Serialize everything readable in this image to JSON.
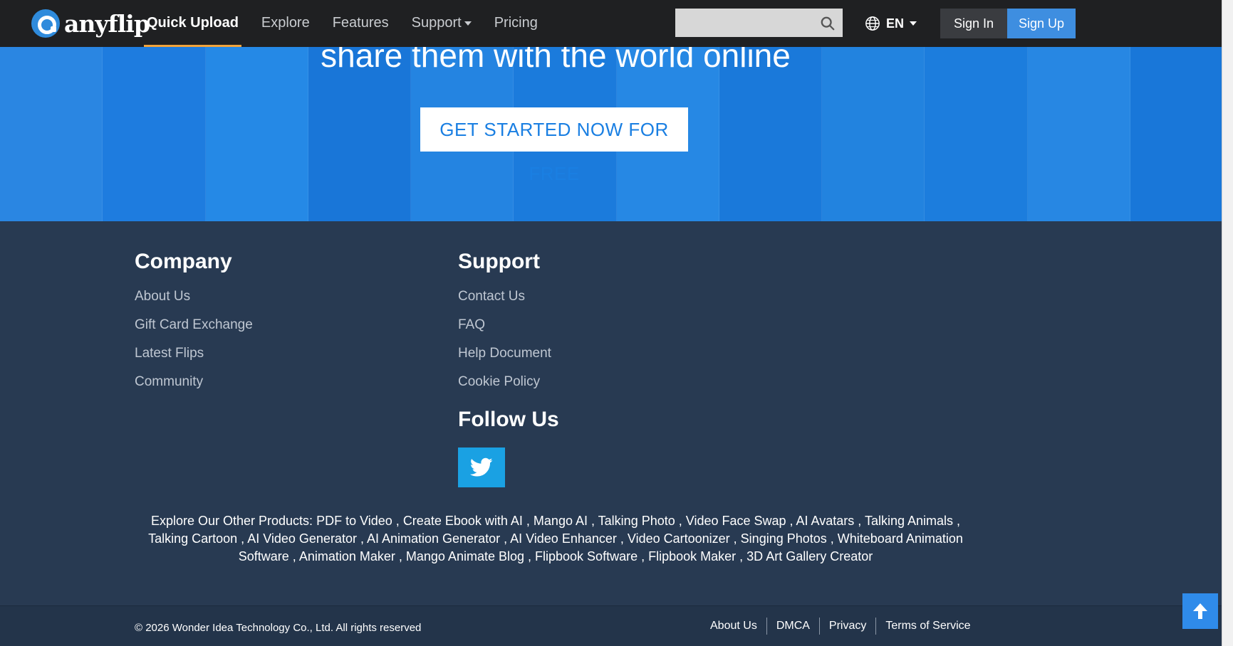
{
  "header": {
    "logo_text": "anyflip",
    "nav": [
      {
        "label": "Quick Upload"
      },
      {
        "label": "Explore"
      },
      {
        "label": "Features"
      },
      {
        "label": "Support"
      },
      {
        "label": "Pricing"
      }
    ],
    "search_placeholder": "",
    "language": "EN",
    "sign_in": "Sign In",
    "sign_up": "Sign Up"
  },
  "hero": {
    "heading": "share them with the world online",
    "cta": "GET STARTED NOW FOR FREE"
  },
  "footer": {
    "company": {
      "title": "Company",
      "links": [
        "About Us",
        "Gift Card Exchange",
        "Latest Flips",
        "Community"
      ]
    },
    "support": {
      "title": "Support",
      "links": [
        "Contact Us",
        "FAQ",
        "Help Document",
        "Cookie Policy"
      ]
    },
    "follow_title": "Follow Us",
    "products_prefix": "Explore Our Other Products:",
    "products": [
      "PDF to Video",
      "Create Ebook with AI",
      "Mango AI",
      "Talking Photo",
      "Video Face Swap",
      "AI Avatars",
      "Talking Animals",
      "Talking Cartoon",
      "AI Video Generator",
      "AI Animation Generator",
      "AI Video Enhancer",
      "Video Cartoonizer",
      "Singing Photos",
      "Whiteboard Animation Software",
      "Animation Maker",
      "Mango Animate Blog",
      "Flipbook Software",
      "Flipbook Maker",
      "3D Art Gallery Creator"
    ],
    "copyright": "© 2026 Wonder Idea Technology Co., Ltd. All rights reserved",
    "bottom_links": [
      "About Us",
      "DMCA",
      "Privacy",
      "Terms of Service"
    ]
  },
  "colors": {
    "topbar": "#1f2022",
    "accent": "#f2a33a",
    "hero_blue": "#1a7fe2",
    "footer_bg": "#283a52",
    "sign_up": "#3e8ee0",
    "twitter": "#1aa1e3"
  }
}
